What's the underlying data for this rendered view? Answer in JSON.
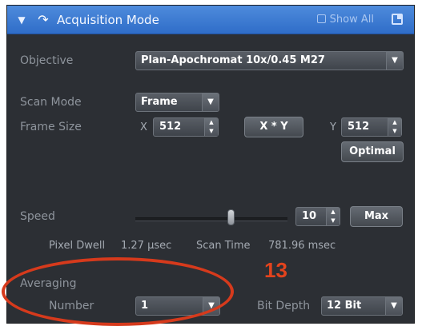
{
  "titlebar": {
    "collapse_icon": "▼",
    "mode_icon": "↷",
    "title": "Acquisition Mode",
    "show_all": "Show All"
  },
  "objective": {
    "label": "Objective",
    "value": "Plan-Apochromat 10x/0.45 M27"
  },
  "scan_mode": {
    "label": "Scan Mode",
    "value": "Frame"
  },
  "frame_size": {
    "label": "Frame Size",
    "x_label": "X",
    "x_value": "512",
    "link_button": "X * Y",
    "y_label": "Y",
    "y_value": "512",
    "optimal_button": "Optimal"
  },
  "speed": {
    "label": "Speed",
    "value": "10",
    "level_fraction": 0.63,
    "max_button": "Max"
  },
  "timing": {
    "pixel_dwell_label": "Pixel Dwell",
    "pixel_dwell_value": "1.27 µsec",
    "scan_time_label": "Scan Time",
    "scan_time_value": "781.96 msec"
  },
  "averaging": {
    "section_label": "Averaging",
    "number_label": "Number",
    "number_value": "1",
    "bit_depth_label": "Bit Depth",
    "bit_depth_value": "12 Bit"
  },
  "annotation": {
    "step_number": "13",
    "color": "#d63a1c"
  }
}
